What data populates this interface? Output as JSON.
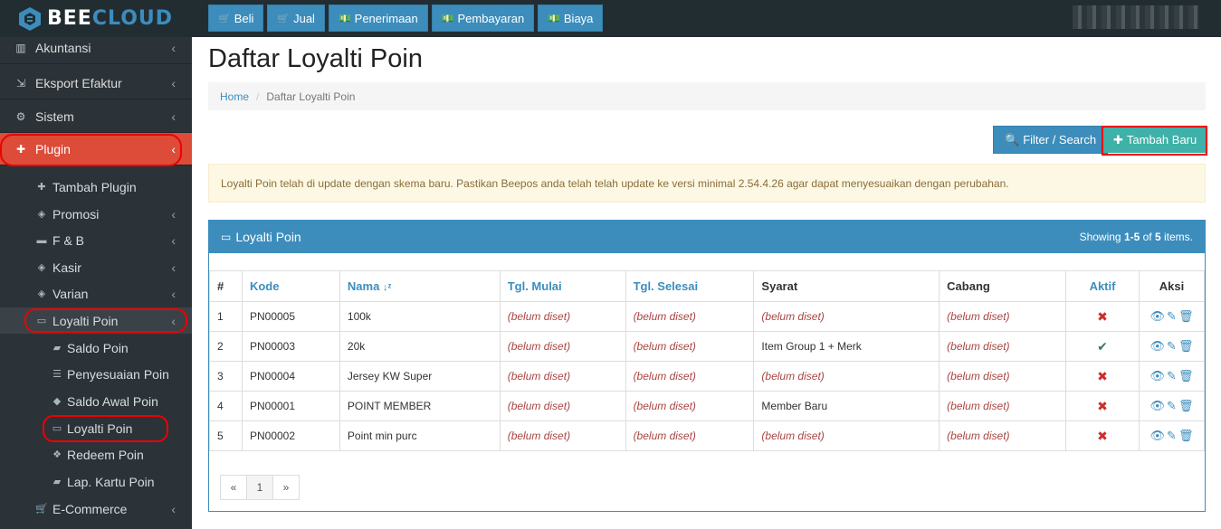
{
  "app": {
    "logo_text": "BEE",
    "logo_text_accent": "CLOUD"
  },
  "top_actions": [
    {
      "label": "Beli",
      "icon": "cart-icon"
    },
    {
      "label": "Jual",
      "icon": "cart-icon"
    },
    {
      "label": "Penerimaan",
      "icon": "money-icon"
    },
    {
      "label": "Pembayaran",
      "icon": "money-icon"
    },
    {
      "label": "Biaya",
      "icon": "money-icon"
    }
  ],
  "sidebar": {
    "items": [
      {
        "label": "Akuntansi",
        "icon": "bar-chart-icon"
      },
      {
        "label": "Eksport Efaktur",
        "icon": "export-icon"
      },
      {
        "label": "Sistem",
        "icon": "gears-icon"
      },
      {
        "label": "Plugin",
        "icon": "puzzle-icon"
      }
    ],
    "plugin_children": [
      {
        "label": "Tambah Plugin",
        "icon": "plus-icon"
      },
      {
        "label": "Promosi",
        "icon": "tags-icon"
      },
      {
        "label": "F & B",
        "icon": "keyboard-icon"
      },
      {
        "label": "Kasir",
        "icon": "tags-icon"
      },
      {
        "label": "Varian",
        "icon": "tags-icon"
      },
      {
        "label": "Loyalti Poin",
        "icon": "card-icon"
      }
    ],
    "loyalti_children": [
      {
        "label": "Saldo Poin",
        "icon": "book-icon"
      },
      {
        "label": "Penyesuaian Poin",
        "icon": "sliders-icon"
      },
      {
        "label": "Saldo Awal Poin",
        "icon": "tag-icon"
      },
      {
        "label": "Loyalti Poin",
        "icon": "card-icon"
      },
      {
        "label": "Redeem Poin",
        "icon": "gift-icon"
      },
      {
        "label": "Lap. Kartu Poin",
        "icon": "book-icon"
      }
    ],
    "ecommerce": {
      "label": "E-Commerce",
      "icon": "cart-icon"
    }
  },
  "page": {
    "title": "Daftar Loyalti Poin",
    "breadcrumb_home": "Home",
    "breadcrumb_current": "Daftar Loyalti Poin",
    "filter_label": "Filter / Search",
    "add_label": "Tambah Baru",
    "alert": "Loyalti Poin telah di update dengan skema baru. Pastikan Beepos anda telah telah update ke versi minimal 2.54.4.26 agar dapat menyesuaikan dengan perubahan."
  },
  "panel": {
    "title": "Loyalti Poin",
    "summary_prefix": "Showing ",
    "summary_range": "1-5",
    "summary_mid": " of ",
    "summary_total": "5",
    "summary_suffix": " items."
  },
  "table": {
    "headers": [
      "#",
      "Kode",
      "Nama",
      "Tgl. Mulai",
      "Tgl. Selesai",
      "Syarat",
      "Cabang",
      "Aktif",
      "Aksi"
    ],
    "rows": [
      {
        "no": "1",
        "kode": "PN00005",
        "nama": "100k",
        "mulai": "(belum diset)",
        "selesai": "(belum diset)",
        "syarat": "(belum diset)",
        "syarat_set": false,
        "cabang": "(belum diset)",
        "aktif": false
      },
      {
        "no": "2",
        "kode": "PN00003",
        "nama": "20k",
        "mulai": "(belum diset)",
        "selesai": "(belum diset)",
        "syarat": "Item Group 1 + Merk",
        "syarat_set": true,
        "cabang": "(belum diset)",
        "aktif": true
      },
      {
        "no": "3",
        "kode": "PN00004",
        "nama": "Jersey KW Super",
        "mulai": "(belum diset)",
        "selesai": "(belum diset)",
        "syarat": "(belum diset)",
        "syarat_set": false,
        "cabang": "(belum diset)",
        "aktif": false
      },
      {
        "no": "4",
        "kode": "PN00001",
        "nama": "POINT MEMBER",
        "mulai": "(belum diset)",
        "selesai": "(belum diset)",
        "syarat": "Member Baru",
        "syarat_set": true,
        "cabang": "(belum diset)",
        "aktif": false
      },
      {
        "no": "5",
        "kode": "PN00002",
        "nama": "Point min purc",
        "mulai": "(belum diset)",
        "selesai": "(belum diset)",
        "syarat": "(belum diset)",
        "syarat_set": false,
        "cabang": "(belum diset)",
        "aktif": false
      }
    ]
  },
  "pager": {
    "prev": "«",
    "current": "1",
    "next": "»"
  },
  "colors": {
    "primary": "#3c8dbc",
    "danger": "#dd4b39",
    "teal": "#3fb1a8",
    "sidebar": "#2c3338"
  }
}
